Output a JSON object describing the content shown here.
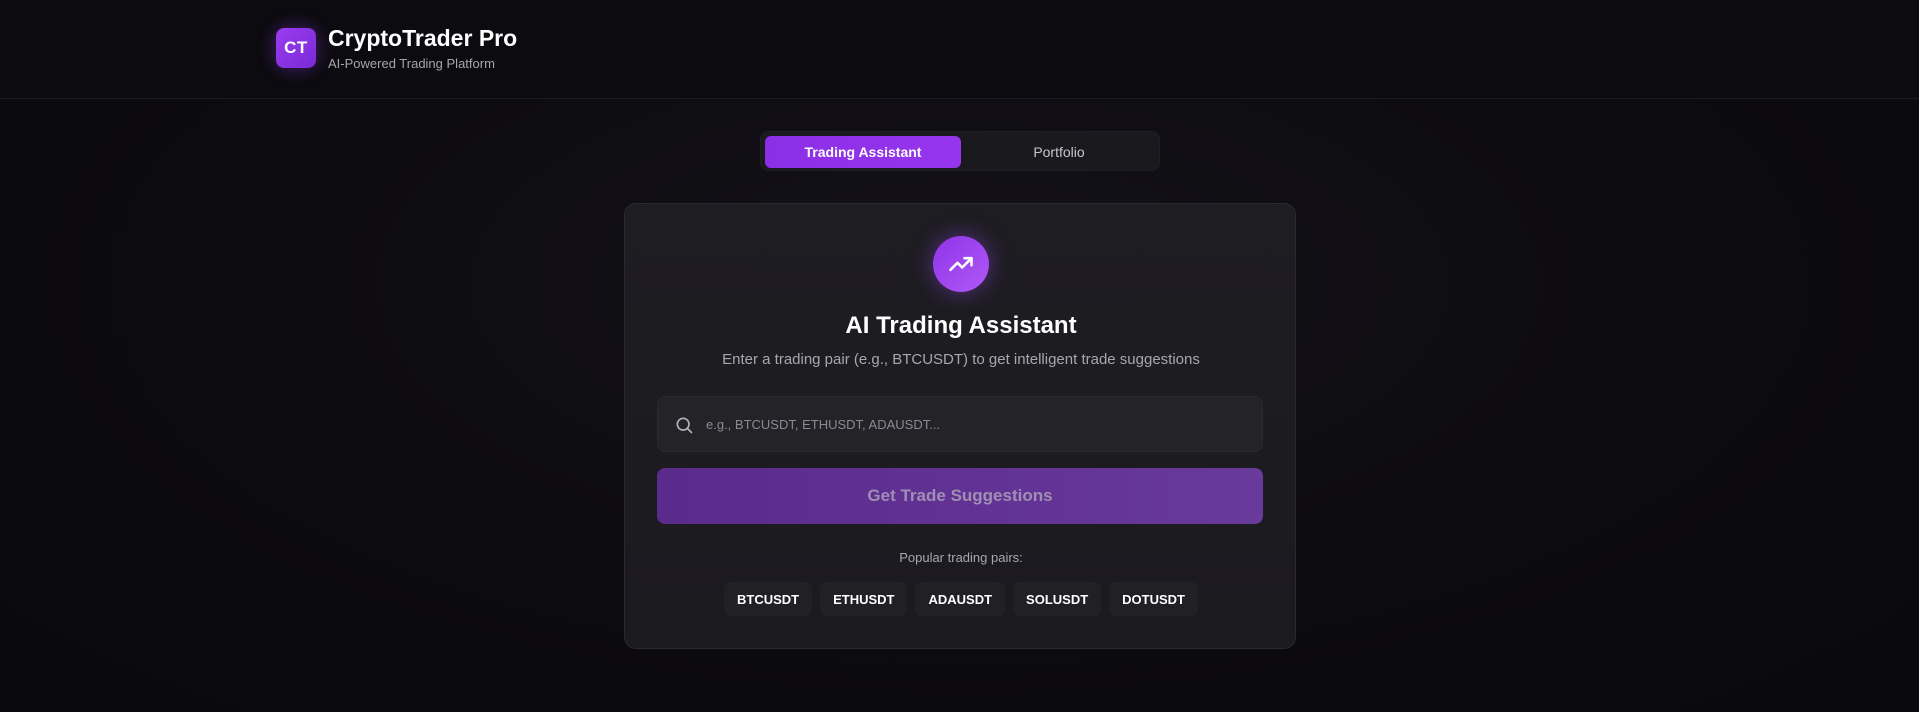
{
  "header": {
    "logo_text": "CT",
    "title": "CryptoTrader Pro",
    "subtitle": "AI-Powered Trading Platform"
  },
  "tabs": [
    {
      "label": "Trading Assistant",
      "active": true
    },
    {
      "label": "Portfolio",
      "active": false
    }
  ],
  "assistant": {
    "icon": "trending-up-icon",
    "title": "AI Trading Assistant",
    "description": "Enter a trading pair (e.g., BTCUSDT) to get intelligent trade suggestions",
    "search": {
      "placeholder": "e.g., BTCUSDT, ETHUSDT, ADAUSDT...",
      "value": ""
    },
    "submit_label": "Get Trade Suggestions",
    "popular_label": "Popular trading pairs:",
    "pairs": [
      "BTCUSDT",
      "ETHUSDT",
      "ADAUSDT",
      "SOLUSDT",
      "DOTUSDT"
    ]
  },
  "colors": {
    "accent": "#8b2fe6",
    "background": "#0d0c10",
    "card": "#1d1c21"
  }
}
